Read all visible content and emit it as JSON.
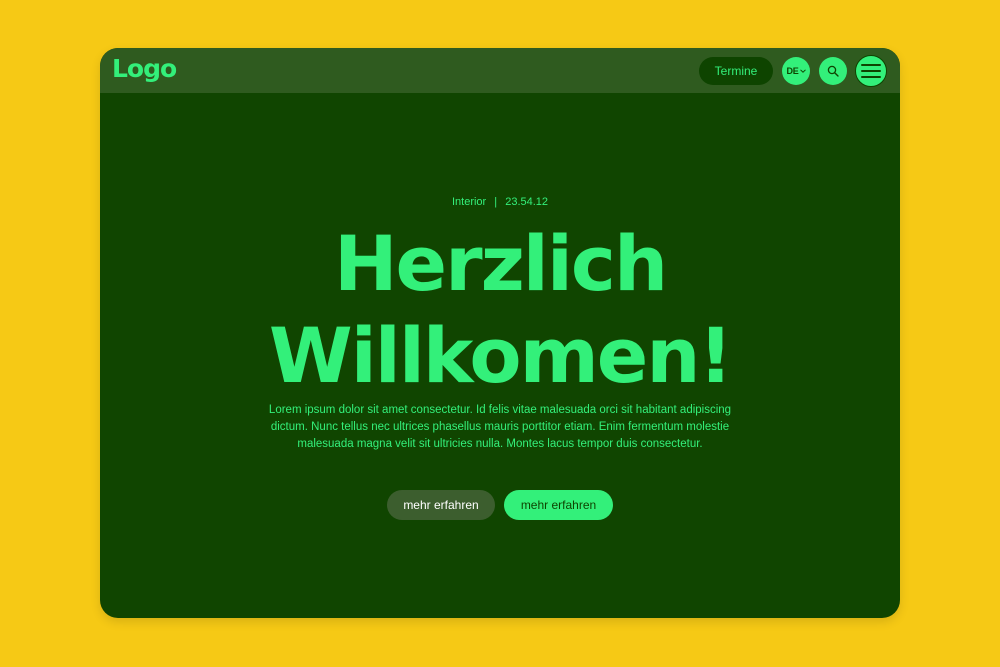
{
  "nav": {
    "logo": "Logo",
    "termine_label": "Termine",
    "language": "DE",
    "search_icon": "search-icon",
    "menu_icon": "hamburger-menu-icon"
  },
  "hero": {
    "category": "Interior",
    "separator": "|",
    "date": "23.54.12",
    "headline_line1": "Herzlich",
    "headline_line2": "Willkomen!",
    "body": "Lorem ipsum dolor sit amet consectetur. Id felis vitae malesuada orci sit habitant adipiscing dictum. Nunc tellus nec ultrices phasellus mauris porttitor etiam. Enim fermentum molestie malesuada magna velit sit ultricies nulla. Montes lacus tempor duis consectetur.",
    "cta_secondary": "mehr erfahren",
    "cta_primary": "mehr erfahren"
  },
  "colors": {
    "page_background": "#F6C915",
    "card_background": "#104500",
    "nav_background": "#2F5B1F",
    "accent": "#33F07A"
  }
}
